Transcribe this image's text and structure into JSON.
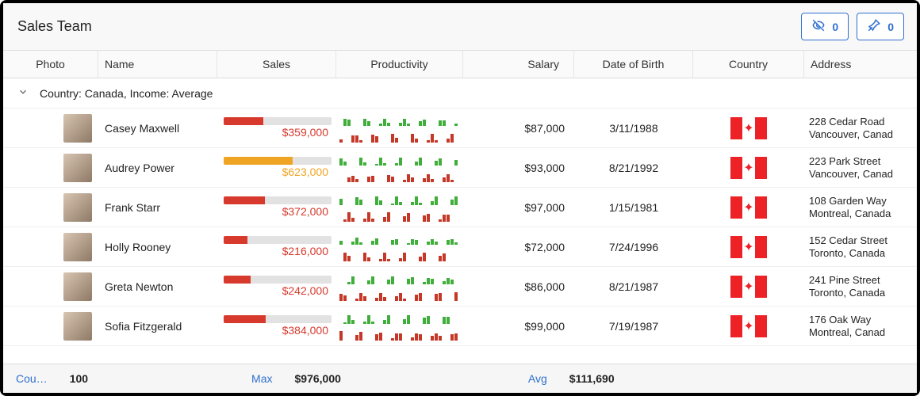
{
  "header": {
    "title": "Sales Team",
    "badge_hidden": "0",
    "badge_pinned": "0"
  },
  "columns": {
    "photo": "Photo",
    "name": "Name",
    "sales": "Sales",
    "productivity": "Productivity",
    "salary": "Salary",
    "dob": "Date of Birth",
    "country": "Country",
    "address": "Address"
  },
  "group": {
    "label": "Country: Canada, Income: Average"
  },
  "rows": [
    {
      "name": "Casey Maxwell",
      "sales_value": "$359,000",
      "sales_pct": 37,
      "sales_color": "#d73a2d",
      "salary": "$87,000",
      "dob": "3/11/1988",
      "country": "Canada",
      "addr1": "228 Cedar Road",
      "addr2": "Vancouver, Canad"
    },
    {
      "name": "Audrey Power",
      "sales_value": "$623,000",
      "sales_pct": 64,
      "sales_color": "#f0a423",
      "salary": "$93,000",
      "dob": "8/21/1992",
      "country": "Canada",
      "addr1": "223 Park Street",
      "addr2": "Vancouver, Canad"
    },
    {
      "name": "Frank Starr",
      "sales_value": "$372,000",
      "sales_pct": 38,
      "sales_color": "#d73a2d",
      "salary": "$97,000",
      "dob": "1/15/1981",
      "country": "Canada",
      "addr1": "108 Garden Way",
      "addr2": "Montreal, Canada"
    },
    {
      "name": "Holly Rooney",
      "sales_value": "$216,000",
      "sales_pct": 22,
      "sales_color": "#d73a2d",
      "salary": "$72,000",
      "dob": "7/24/1996",
      "country": "Canada",
      "addr1": "152 Cedar Street",
      "addr2": "Toronto, Canada"
    },
    {
      "name": "Greta Newton",
      "sales_value": "$242,000",
      "sales_pct": 25,
      "sales_color": "#d73a2d",
      "salary": "$86,000",
      "dob": "8/21/1987",
      "country": "Canada",
      "addr1": "241 Pine Street",
      "addr2": "Toronto, Canada"
    },
    {
      "name": "Sofia Fitzgerald",
      "sales_value": "$384,000",
      "sales_pct": 39,
      "sales_color": "#d73a2d",
      "salary": "$99,000",
      "dob": "7/19/1987",
      "country": "Canada",
      "addr1": "176 Oak Way",
      "addr2": "Montreal, Canad"
    }
  ],
  "footer": {
    "count_label": "Cou…",
    "count_value": "100",
    "max_label": "Max",
    "max_value": "$976,000",
    "avg_label": "Avg",
    "avg_value": "$111,690"
  },
  "chart_data": {
    "type": "table",
    "title": "Sales Team",
    "columns": [
      "Name",
      "Sales",
      "Salary",
      "Date of Birth",
      "Country",
      "Address"
    ],
    "series": [
      {
        "name": "Sales",
        "values": [
          359000,
          623000,
          372000,
          216000,
          242000,
          384000
        ]
      },
      {
        "name": "Salary",
        "values": [
          87000,
          93000,
          97000,
          72000,
          86000,
          99000
        ]
      }
    ],
    "categories": [
      "Casey Maxwell",
      "Audrey Power",
      "Frank Starr",
      "Holly Rooney",
      "Greta Newton",
      "Sofia Fitzgerald"
    ],
    "aggregates": {
      "count": 100,
      "max_sales": 976000,
      "avg_salary": 111690
    }
  }
}
